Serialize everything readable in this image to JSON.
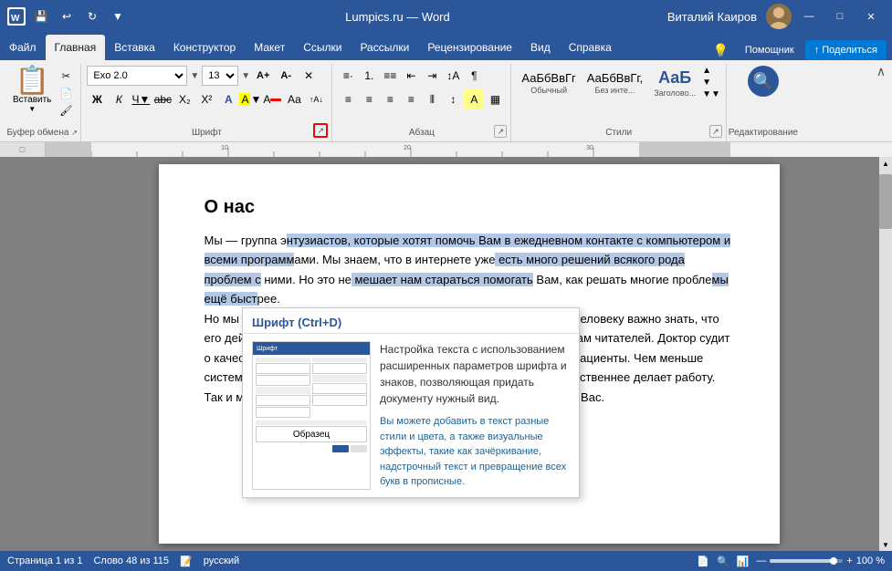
{
  "titleBar": {
    "title": "Lumpics.ru — Word",
    "userName": "Виталий Каиров",
    "windowControls": {
      "minimize": "—",
      "maximize": "□",
      "close": "✕"
    }
  },
  "ribbonTabs": [
    {
      "label": "Файл",
      "active": false
    },
    {
      "label": "Главная",
      "active": true
    },
    {
      "label": "Вставка",
      "active": false
    },
    {
      "label": "Конструктор",
      "active": false
    },
    {
      "label": "Макет",
      "active": false
    },
    {
      "label": "Ссылки",
      "active": false
    },
    {
      "label": "Рассылки",
      "active": false
    },
    {
      "label": "Рецензирование",
      "active": false
    },
    {
      "label": "Вид",
      "active": false
    },
    {
      "label": "Справка",
      "active": false
    }
  ],
  "ribbonRight": [
    {
      "label": "Помощник"
    },
    {
      "label": "Поделиться"
    }
  ],
  "groups": {
    "clipboard": {
      "label": "Буфер обмена"
    },
    "font": {
      "label": "Шрифт",
      "fontName": "Exo 2.0",
      "fontSize": "13"
    },
    "paragraph": {
      "label": "Абзац"
    },
    "styles": {
      "label": "Стили",
      "items": [
        {
          "preview": "АаБбВвГг",
          "label": "Обычный"
        },
        {
          "preview": "АаБбВвГг,",
          "label": "Без инте..."
        },
        {
          "preview": "АаБ",
          "label": "Заголово..."
        }
      ]
    },
    "editing": {
      "label": "Редактирование"
    }
  },
  "tooltip": {
    "title": "Шрифт (Ctrl+D)",
    "mainDesc": "Настройка текста с использованием расширенных параметров шрифта и знаков, позволяющая придать документу нужный вид.",
    "secDesc": "Вы можете добавить в текст разные стили и цвета, а также визуальные эффекты, такие как зачёркивание, надстрочный текст и превращение всех букв в прописные."
  },
  "document": {
    "title": "О нас",
    "para1": "Мы — группа э",
    "para1selected": "нтузиастов, которые хотят помочь",
    "para1cont": " Вам в ежедневном контакте с ком",
    "para1sel2": "пьютером и всеми программ",
    "para1cont2": "ами. Мы знаем, что в интернете уже",
    "para1sel3": " есть много решений всякого рода проблем с",
    "para1cont3": " ними. Но это не",
    "para1sel4": " мешает нам стараться помогать",
    "para1cont4": " Вам, как решать многие пробле",
    "para1sel5": "мы ещё быст",
    "para1cont5": "рее.",
    "para2": "Но мы не сможем это сделать без вашей обратной связи. Любому человеку важно знать, что его действия правильные. Писатель судит о своей работе по отзывам читателей. Доктор судит о качестве своей работы по тому, как быстро выздоравливают его пациенты. Чем меньше системный администратор бегает и что-то настраивает, тем он качественнее делает работу. Так и мы не можем улучшаться, если не будем получать ответов от Вас."
  },
  "statusBar": {
    "page": "Страница 1 из 1",
    "words": "Слово 48 из 115",
    "lang": "русский",
    "zoom": "100 %"
  }
}
